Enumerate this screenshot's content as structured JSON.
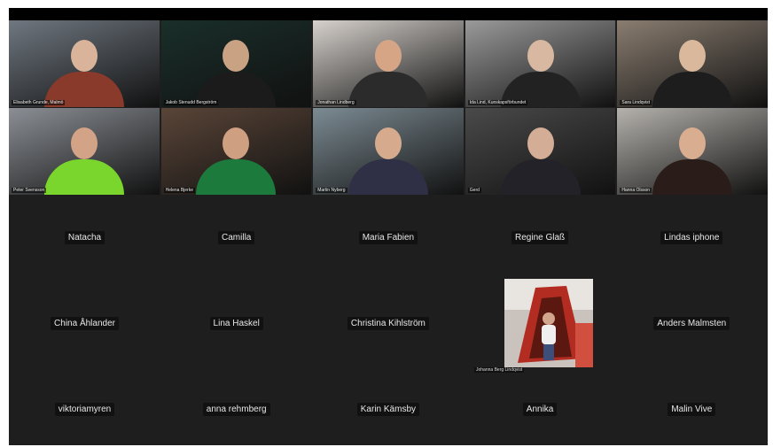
{
  "window": {
    "title": ""
  },
  "video_tiles": [
    {
      "id": "v1",
      "label": "Elisabeth Grunde, Malmö",
      "bg": "#6f7780",
      "skin": "#d9b49a",
      "shirt": "#8a3a2a"
    },
    {
      "id": "v2",
      "label": "Jakob Stenudd Bergström",
      "bg": "#1a2f2a",
      "skin": "#c9a183",
      "shirt": "#1b1b1b"
    },
    {
      "id": "v3",
      "label": "Jonathan Lindberg",
      "bg": "#d6d1cc",
      "skin": "#d5a585",
      "shirt": "#2b2b2b"
    },
    {
      "id": "v4",
      "label": "Ida Lind, Kunskapsförbundet",
      "bg": "#9a9a9a",
      "skin": "#d8b8a0",
      "shirt": "#222222"
    },
    {
      "id": "v5",
      "label": "Sara Lindqvist",
      "bg": "#8a7d70",
      "skin": "#d9b89b",
      "shirt": "#1d1d1d"
    },
    {
      "id": "v6",
      "label": "Peter Svensson",
      "bg": "#8b8f95",
      "skin": "#d2a386",
      "shirt": "#7ad62c"
    },
    {
      "id": "v7",
      "label": "Helena Bjerke",
      "bg": "#5a4538",
      "skin": "#cf9f82",
      "shirt": "#1c7a3c"
    },
    {
      "id": "v8",
      "label": "Martin Nyberg",
      "bg": "#7c8b93",
      "skin": "#d6aa8c",
      "shirt": "#2f2f45"
    },
    {
      "id": "v9",
      "label": "Gerd",
      "bg": "#4a4a4a",
      "skin": "#d3ad95",
      "shirt": "#222228"
    },
    {
      "id": "v10",
      "label": "Hanna Olsson",
      "bg": "#b5b2ad",
      "skin": "#d9ae90",
      "shirt": "#2a1c18"
    }
  ],
  "participants": [
    {
      "name": "Natacha"
    },
    {
      "name": "Camilla"
    },
    {
      "name": "Maria Fabien"
    },
    {
      "name": "Regine Glaß"
    },
    {
      "name": "Lindas iphone"
    },
    {
      "name": "China Åhlander"
    },
    {
      "name": "Lina Haskel"
    },
    {
      "name": "Christina Kihlström"
    },
    {
      "name": ""
    },
    {
      "name": "Anders Malmsten"
    },
    {
      "name": "viktoriamyren"
    },
    {
      "name": "anna rehmberg"
    },
    {
      "name": "Karin Kämsby"
    },
    {
      "name": "Annika"
    },
    {
      "name": "Malin Vive"
    }
  ],
  "thumbnail": {
    "label": "Johanna Berg Lindqvist"
  }
}
